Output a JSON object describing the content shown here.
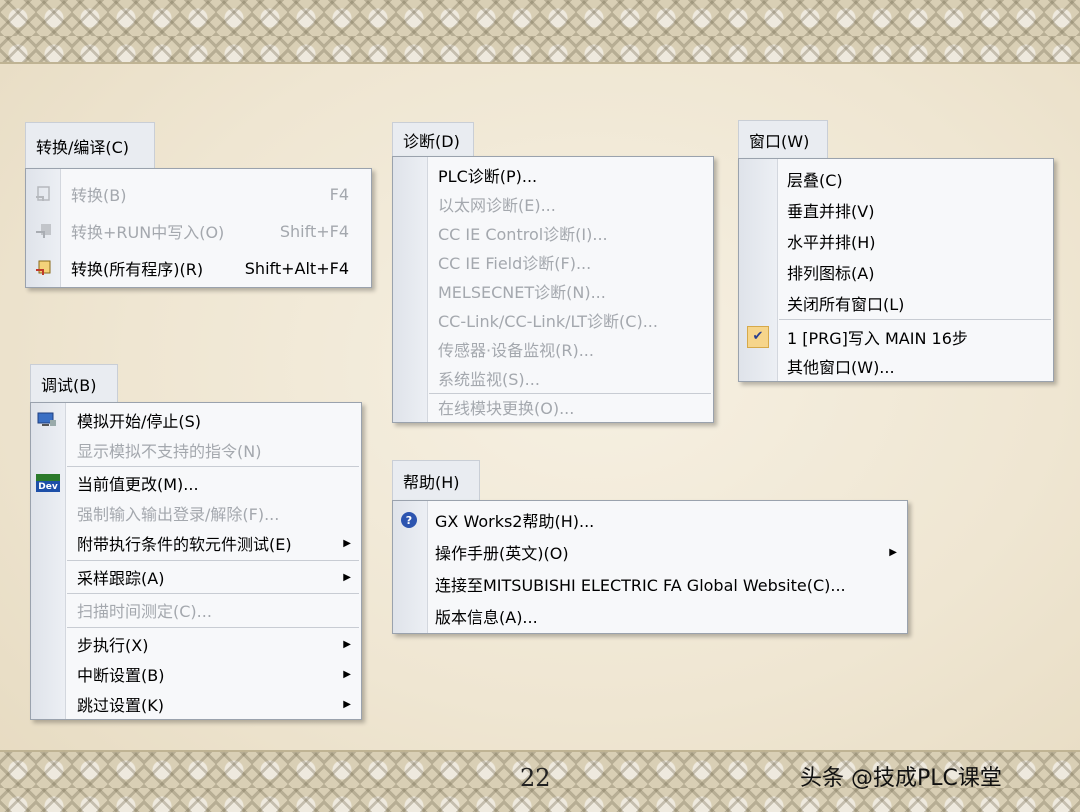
{
  "convert_menu": {
    "title": "转换/编译(C)",
    "items": [
      {
        "label": "转换(B)",
        "shortcut": "F4"
      },
      {
        "label": "转换+RUN中写入(O)",
        "shortcut": "Shift+F4"
      },
      {
        "label": "转换(所有程序)(R)",
        "shortcut": "Shift+Alt+F4"
      }
    ]
  },
  "diag_menu": {
    "title": "诊断(D)",
    "items": [
      {
        "label": "PLC诊断(P)..."
      },
      {
        "label": "以太网诊断(E)..."
      },
      {
        "label": "CC IE Control诊断(I)..."
      },
      {
        "label": "CC IE Field诊断(F)..."
      },
      {
        "label": "MELSECNET诊断(N)..."
      },
      {
        "label": "CC-Link/CC-Link/LT诊断(C)..."
      },
      {
        "label": "传感器·设备监视(R)..."
      },
      {
        "label": "系统监视(S)..."
      },
      {
        "label": "在线模块更换(O)..."
      }
    ]
  },
  "window_menu": {
    "title": "窗口(W)",
    "items": [
      {
        "label": "层叠(C)"
      },
      {
        "label": "垂直并排(V)"
      },
      {
        "label": "水平并排(H)"
      },
      {
        "label": "排列图标(A)"
      },
      {
        "label": "关闭所有窗口(L)"
      },
      {
        "label": "1 [PRG]写入 MAIN 16步"
      },
      {
        "label": "其他窗口(W)..."
      }
    ]
  },
  "debug_menu": {
    "title": "调试(B)",
    "items": [
      {
        "label": "模拟开始/停止(S)"
      },
      {
        "label": "显示模拟不支持的指令(N)"
      },
      {
        "label": "当前值更改(M)..."
      },
      {
        "label": "强制输入输出登录/解除(F)..."
      },
      {
        "label": "附带执行条件的软元件测试(E)"
      },
      {
        "label": "采样跟踪(A)"
      },
      {
        "label": "扫描时间测定(C)..."
      },
      {
        "label": "步执行(X)"
      },
      {
        "label": "中断设置(B)"
      },
      {
        "label": "跳过设置(K)"
      }
    ]
  },
  "help_menu": {
    "title": "帮助(H)",
    "items": [
      {
        "label": "GX Works2帮助(H)..."
      },
      {
        "label": "操作手册(英文)(O)"
      },
      {
        "label": "连接至MITSUBISHI ELECTRIC FA Global Website(C)..."
      },
      {
        "label": "版本信息(A)..."
      }
    ]
  },
  "icons": {
    "dev_badge": "Dev",
    "help": "?",
    "check": "✔"
  },
  "footer": {
    "page_number": "22",
    "watermark": "头条 @技成PLC课堂"
  }
}
